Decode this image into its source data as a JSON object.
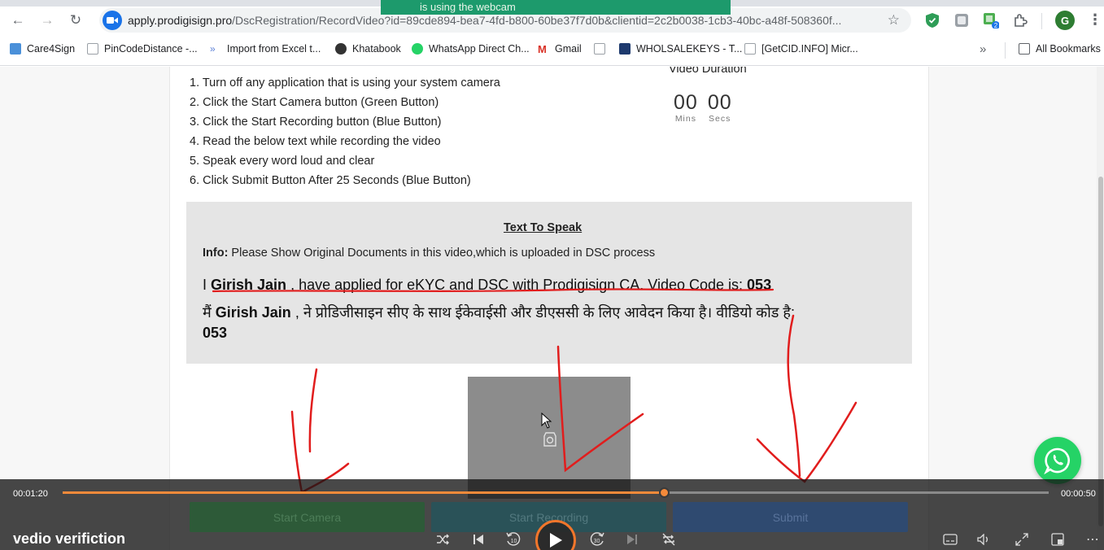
{
  "browser": {
    "url_host": "apply.prodigisign.pro",
    "url_path": "/DscRegistration/RecordVideo?id=89cde894-bea7-4fd-b800-60be37f7d0b&clientid=2c2b0038-1cb3-40bc-a48f-508360f...",
    "notification": "is using the webcam",
    "profile_initial": "G",
    "extension_badge": "2",
    "bookmarks": [
      "Care4Sign",
      "PinCodeDistance -...",
      "Import from Excel t...",
      "Khatabook",
      "WhatsApp Direct Ch...",
      "Gmail",
      "",
      "WHOLSALEKEYS - T...",
      "[GetCID.INFO] Micr..."
    ],
    "all_bookmarks_label": "All Bookmarks"
  },
  "instructions": [
    "1. Turn off any application that is using your system camera",
    "2. Click the Start Camera button (Green Button)",
    "3. Click the Start Recording button (Blue Button)",
    "4. Read the below text while recording the video",
    "5. Speak every word loud and clear",
    "6. Click Submit Button After 25 Seconds (Blue Button)"
  ],
  "timer": {
    "title": "Video Duration",
    "mins": "00",
    "secs": "00",
    "mins_label": "Mins",
    "secs_label": "Secs"
  },
  "speak": {
    "title": "Text To Speak",
    "info_label": "Info:",
    "info_text": " Please Show Original Documents in this video,which is uploaded in DSC process",
    "en_prefix": "I ",
    "name": "Girish Jain",
    "en_middle": " , have applied for eKYC and DSC with Prodigisign CA. Video Code is: ",
    "code": "053",
    "hi_prefix": "मैं ",
    "hi_middle": " , ने प्रोडिजीसाइन सीए के साथ ईकेवाईसी और डीएससी के लिए आवेदन किया है। वीडियो कोड है: "
  },
  "buttons": {
    "start_camera": "Start Camera",
    "start_recording": "Start Recording",
    "submit": "Submit"
  },
  "player": {
    "elapsed": "00:01:20",
    "remaining": "00:00:50",
    "progress": 0.61,
    "title": "vedio verifiction",
    "rewind_label": "10",
    "forward_label": "30"
  },
  "colors": {
    "camera_btn": "#2d5a38",
    "record_btn": "#2a5258",
    "submit_btn": "#2f4a70",
    "accent": "#f48a3a",
    "whatsapp": "#25d366"
  }
}
